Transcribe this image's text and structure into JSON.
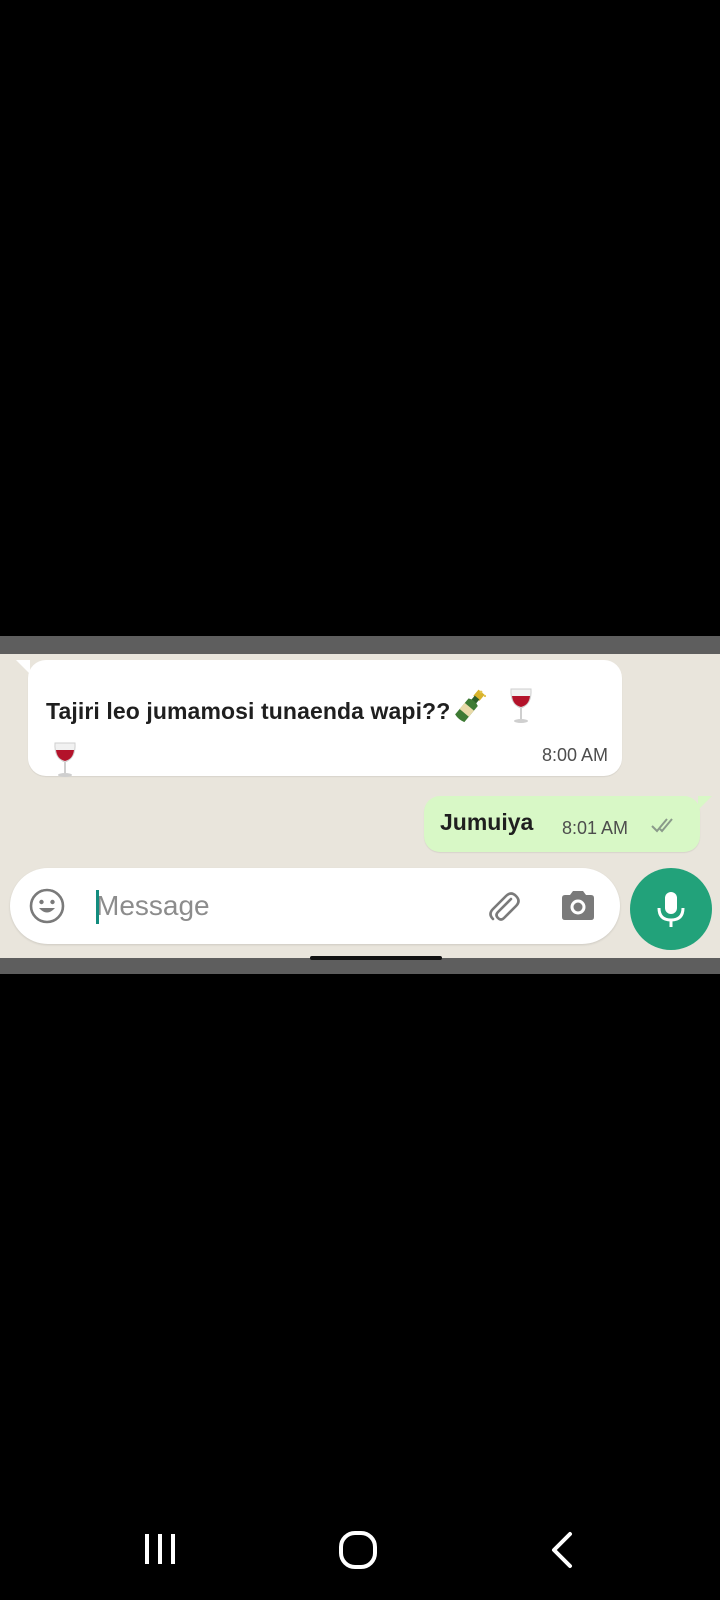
{
  "chat": {
    "incoming": {
      "text": "Tajiri leo jumamosi tunaenda wapi??",
      "emojis": [
        "bottle-icon",
        "wine-glass-icon",
        "wine-glass-icon"
      ],
      "time": "8:00 AM"
    },
    "outgoing": {
      "text": "Jumuiya",
      "time": "8:01 AM",
      "status": "read-ticks-icon"
    }
  },
  "composer": {
    "placeholder": "Message",
    "icons": {
      "emoji": "emoji-icon",
      "attach": "paperclip-icon",
      "camera": "camera-icon",
      "mic": "microphone-icon"
    }
  },
  "navbar": {
    "recents": "recents-icon",
    "home": "home-icon",
    "back": "back-icon"
  },
  "colors": {
    "chat_background": "#e9e5dc",
    "outgoing_bubble": "#d8f8c6",
    "incoming_bubble": "#ffffff",
    "accent": "#22a27a"
  }
}
